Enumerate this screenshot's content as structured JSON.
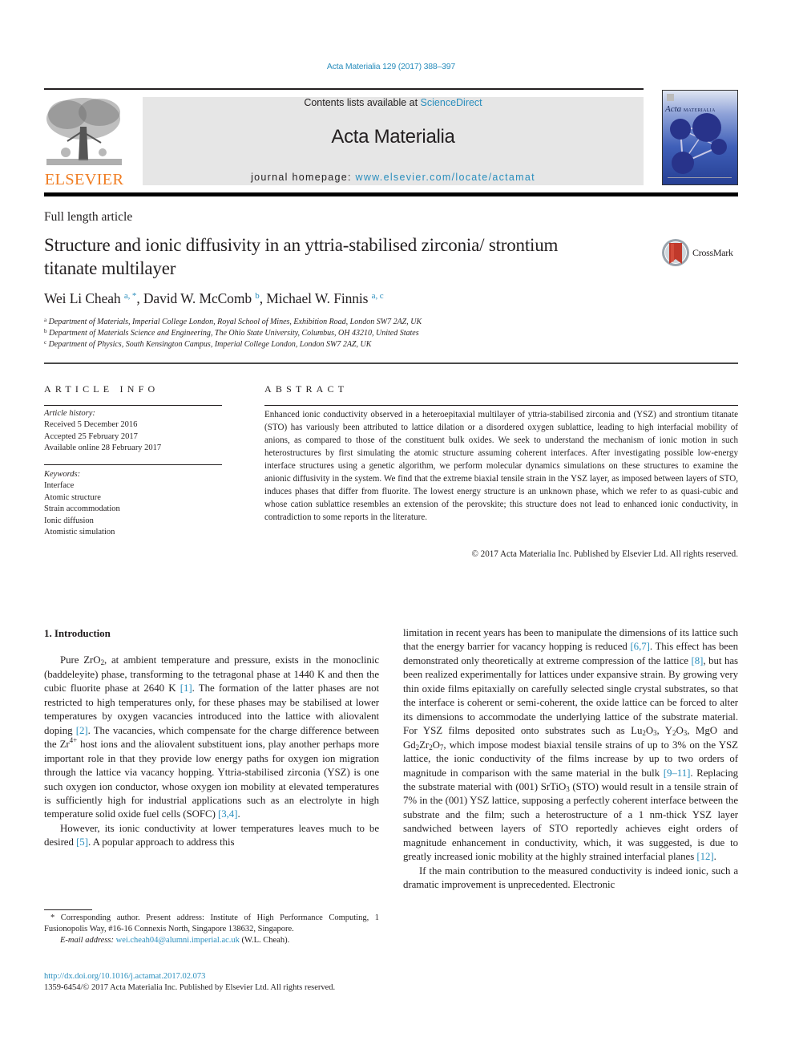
{
  "journal_ref": "Acta Materialia 129 (2017) 388–397",
  "masthead": {
    "contents_prefix": "Contents lists available at ",
    "contents_link": "ScienceDirect",
    "journal_title": "Acta Materialia",
    "homepage_prefix": "journal homepage: ",
    "homepage_link": "www.elsevier.com/locate/actamat"
  },
  "publisher_logo": {
    "wordmark": "ELSEVIER",
    "icon": "elsevier-tree-icon",
    "color": "#f07e24"
  },
  "cover": {
    "title_italic": "Acta",
    "title_caps": "MATERIALIA",
    "icon": "journal-cover-icon"
  },
  "crossmark": {
    "label": "CrossMark",
    "icon": "crossmark-icon"
  },
  "article": {
    "type": "Full length article",
    "title": "Structure and ionic diffusivity in an yttria-stabilised zirconia/ strontium titanate multilayer",
    "authors": [
      {
        "name": "Wei Li Cheah",
        "sup": "a, *"
      },
      {
        "name": "David W. McComb",
        "sup": "b"
      },
      {
        "name": "Michael W. Finnis",
        "sup": "a, c"
      }
    ],
    "affiliations": [
      {
        "key": "a",
        "text": "Department of Materials, Imperial College London, Royal School of Mines, Exhibition Road, London SW7 2AZ, UK"
      },
      {
        "key": "b",
        "text": "Department of Materials Science and Engineering, The Ohio State University, Columbus, OH 43210, United States"
      },
      {
        "key": "c",
        "text": "Department of Physics, South Kensington Campus, Imperial College London, London SW7 2AZ, UK"
      }
    ]
  },
  "article_info": {
    "heading": "ARTICLE INFO",
    "history_label": "Article history:",
    "history": [
      "Received 5 December 2016",
      "Accepted 25 February 2017",
      "Available online 28 February 2017"
    ],
    "keywords_label": "Keywords:",
    "keywords": [
      "Interface",
      "Atomic structure",
      "Strain accommodation",
      "Ionic diffusion",
      "Atomistic simulation"
    ]
  },
  "abstract": {
    "heading": "ABSTRACT",
    "text": "Enhanced ionic conductivity observed in a heteroepitaxial multilayer of yttria-stabilised zirconia and (YSZ) and strontium titanate (STO) has variously been attributed to lattice dilation or a disordered oxygen sublattice, leading to high interfacial mobility of anions, as compared to those of the constituent bulk oxides. We seek to understand the mechanism of ionic motion in such heterostructures by first simulating the atomic structure assuming coherent interfaces. After investigating possible low-energy interface structures using a genetic algorithm, we perform molecular dynamics simulations on these structures to examine the anionic diffusivity in the system. We find that the extreme biaxial tensile strain in the YSZ layer, as imposed between layers of STO, induces phases that differ from fluorite. The lowest energy structure is an unknown phase, which we refer to as quasi-cubic and whose cation sublattice resembles an extension of the perovskite; this structure does not lead to enhanced ionic conductivity, in contradiction to some reports in the literature.",
    "copyright": "© 2017 Acta Materialia Inc. Published by Elsevier Ltd. All rights reserved."
  },
  "body": {
    "section_heading": "1.  Introduction",
    "left_p1": {
      "a": "Pure ZrO",
      "a_sub": "2",
      "b": ", at ambient temperature and pressure, exists in the monoclinic (baddeleyite) phase, transforming to the tetragonal phase at 1440 K and then the cubic fluorite phase at 2640 K ",
      "ref1": "[1]",
      "c": ". The formation of the latter phases are not restricted to high temperatures only, for these phases may be stabilised at lower temperatures by oxygen vacancies introduced into the lattice with aliovalent doping ",
      "ref2": "[2]",
      "d": ". The vacancies, which compensate for the charge difference between the Zr",
      "d_sup": "4+",
      "e": " host ions and the aliovalent substituent ions, play another perhaps more important role in that they provide low energy paths for oxygen ion migration through the lattice via vacancy hopping. Yttria-stabilised zirconia (YSZ) is one such oxygen ion conductor, whose oxygen ion mobility at elevated temperatures is sufficiently high for industrial applications such as an electrolyte in high temperature solid oxide fuel cells (SOFC) ",
      "ref3": "[3,4]",
      "f": "."
    },
    "left_p2": {
      "a": "However, its ionic conductivity at lower temperatures leaves much to be desired ",
      "ref1": "[5]",
      "b": ". A popular approach to address this"
    },
    "right_p1": {
      "a": "limitation in recent years has been to manipulate the dimensions of its lattice such that the energy barrier for vacancy hopping is reduced ",
      "ref1": "[6,7]",
      "b": ". This effect has been demonstrated only theoretically at extreme compression of the lattice ",
      "ref2": "[8]",
      "c": ", but has been realized experimentally for lattices under expansive strain. By growing very thin oxide films epitaxially on carefully selected single crystal substrates, so that the interface is coherent or semi-coherent, the oxide lattice can be forced to alter its dimensions to accommodate the underlying lattice of the substrate material. For YSZ films deposited onto substrates such as Lu",
      "s1": "2",
      "c2": "O",
      "s2": "3",
      "c3": ", Y",
      "s3": "2",
      "c4": "O",
      "s4": "3",
      "c5": ", MgO and Gd",
      "s5": "2",
      "c6": "Zr",
      "s6": "2",
      "c7": "O",
      "s7": "7",
      "d": ", which impose modest biaxial tensile strains of up to 3% on the YSZ lattice, the ionic conductivity of the films increase by up to two orders of magnitude in comparison with the same material in the bulk ",
      "ref3": "[9–11]",
      "e": ". Replacing the substrate material with (001) SrTiO",
      "s8": "3",
      "f": " (STO) would result in a tensile strain of 7% in the (001) YSZ lattice, supposing a perfectly coherent interface between the substrate and the film; such a heterostructure of a 1 nm-thick YSZ layer sandwiched between layers of STO reportedly achieves eight orders of magnitude enhancement in conductivity, which, it was suggested, is due to greatly increased ionic mobility at the highly strained interfacial planes ",
      "ref4": "[12]",
      "g": "."
    },
    "right_p2": "If the main contribution to the measured conductivity is indeed ionic, such a dramatic improvement is unprecedented. Electronic"
  },
  "footnote": {
    "corresponding": "* Corresponding author. Present address: Institute of High Performance Computing, 1 Fusionopolis Way, #16-16 Connexis North, Singapore 138632, Singapore.",
    "email_label": "E-mail address: ",
    "email": "wei.cheah04@alumni.imperial.ac.uk",
    "email_suffix": " (W.L. Cheah)."
  },
  "doi": "http://dx.doi.org/10.1016/j.actamat.2017.02.073",
  "issn_line": "1359-6454/© 2017 Acta Materialia Inc. Published by Elsevier Ltd. All rights reserved."
}
